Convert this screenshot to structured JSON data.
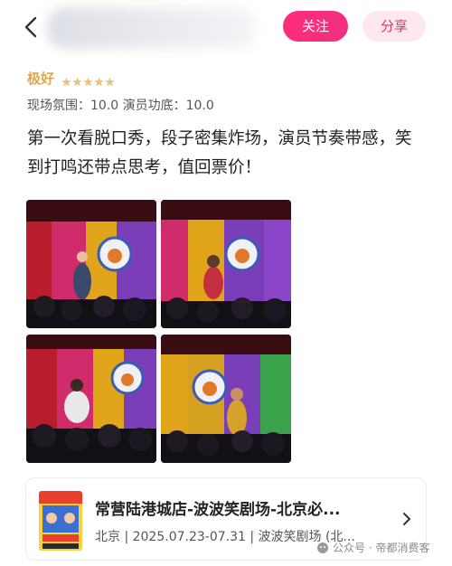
{
  "header": {
    "follow_label": "关注",
    "share_label": "分享"
  },
  "rating": {
    "label": "极好",
    "stars": 5
  },
  "scores": {
    "text": "现场氛围：10.0 演员功底：10.0"
  },
  "review": {
    "text": "第一次看脱口秀，段子密集炸场，演员节奏带感，笑到打鸣还带点思考，值回票价！"
  },
  "photos": [
    {
      "name": "performer-on-stage-photo-1"
    },
    {
      "name": "performer-on-stage-photo-2"
    },
    {
      "name": "performer-on-stage-photo-3"
    },
    {
      "name": "performer-on-stage-photo-4"
    }
  ],
  "show_card": {
    "title": "常营陆港城店-波波笑剧场-北京必...",
    "info": "北京 | 2025.07.23-07.31 | 波波笑剧场 (北..."
  },
  "watermark": {
    "text": "公众号 · 帝都消费客"
  },
  "colors": {
    "accent": "#ff2d7a",
    "share_bg": "#fde8ef",
    "rating": "#e0a64a"
  }
}
